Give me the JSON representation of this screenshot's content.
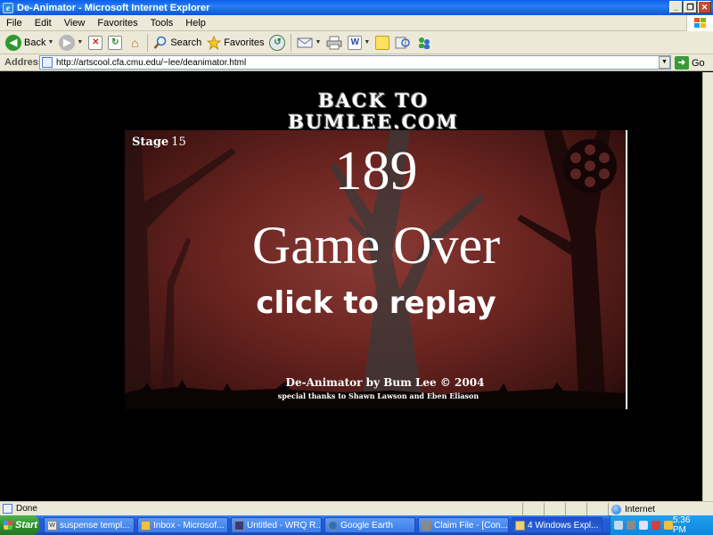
{
  "window": {
    "title": "De-Animator - Microsoft Internet Explorer",
    "minimize": "_",
    "restore": "❐",
    "close": "✕"
  },
  "menu": {
    "items": [
      "File",
      "Edit",
      "View",
      "Favorites",
      "Tools",
      "Help"
    ]
  },
  "toolbar": {
    "back": "Back",
    "search": "Search",
    "favorites": "Favorites"
  },
  "address": {
    "label": "Address",
    "url": "http://artscool.cfa.cmu.edu/~lee/deanimator.html",
    "go": "Go"
  },
  "page": {
    "back_link": "BACK TO BUMLEE.COM",
    "stage_label": "Stage",
    "stage_number": "15",
    "score": "189",
    "game_over": "Game Over",
    "replay": "click to replay",
    "credits": "De-Animator   by Bum Lee © 2004",
    "thanks": "special thanks to Shawn Lawson and Eben Eliason"
  },
  "status": {
    "text": "Done",
    "zone": "Internet"
  },
  "taskbar": {
    "start": "Start",
    "tasks": [
      {
        "label": "suspense templ...",
        "icon": "word-icon"
      },
      {
        "label": "Inbox - Microsof...",
        "icon": "outlook-icon"
      },
      {
        "label": "Untitled - WRQ R...",
        "icon": "terminal-icon"
      },
      {
        "label": "Google Earth",
        "icon": "globe-icon"
      },
      {
        "label": "Claim File - [Con...",
        "icon": "app-icon"
      },
      {
        "label": "4 Windows Expl...",
        "icon": "folder-icon"
      }
    ],
    "clock": "5:36 PM"
  },
  "colors": {
    "title_blue": "#0a5fe8",
    "game_red": "#8a3a35",
    "taskbar_blue": "#245edb",
    "start_green": "#2e8a2e"
  }
}
